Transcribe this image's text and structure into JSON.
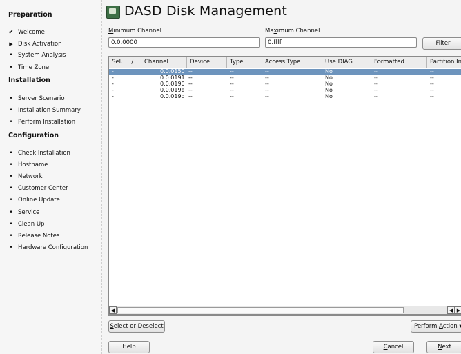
{
  "sidebar": {
    "sections": [
      {
        "title": "Preparation",
        "items": [
          {
            "label": "Welcome",
            "state": "done"
          },
          {
            "label": "Disk Activation",
            "state": "current"
          },
          {
            "label": "System Analysis",
            "state": "pending"
          },
          {
            "label": "Time Zone",
            "state": "pending"
          }
        ]
      },
      {
        "title": "Installation",
        "items": [
          {
            "label": "Server Scenario",
            "state": "pending"
          },
          {
            "label": "Installation Summary",
            "state": "pending"
          },
          {
            "label": "Perform Installation",
            "state": "pending"
          }
        ]
      },
      {
        "title": "Configuration",
        "items": [
          {
            "label": "Check Installation",
            "state": "pending"
          },
          {
            "label": "Hostname",
            "state": "pending"
          },
          {
            "label": "Network",
            "state": "pending"
          },
          {
            "label": "Customer Center",
            "state": "pending"
          },
          {
            "label": "Online Update",
            "state": "pending"
          },
          {
            "label": "Service",
            "state": "pending"
          },
          {
            "label": "Clean Up",
            "state": "pending"
          },
          {
            "label": "Release Notes",
            "state": "pending"
          },
          {
            "label": "Hardware Configuration",
            "state": "pending"
          }
        ]
      }
    ]
  },
  "page": {
    "title": "DASD Disk Management",
    "icon": "disk-management-icon"
  },
  "filters": {
    "min_label_pre": "",
    "min_label_key": "M",
    "min_label_post": "inimum Channel",
    "min_value": "0.0.0000",
    "max_label_pre": "Ma",
    "max_label_key": "x",
    "max_label_post": "imum Channel",
    "max_value": "0.ffff",
    "filter_key": "F",
    "filter_rest": "ilter"
  },
  "table": {
    "columns": [
      "Sel.",
      "Channel",
      "Device",
      "Type",
      "Access Type",
      "Use DIAG",
      "Formatted",
      "Partition Info"
    ],
    "sort_indicator": "/",
    "rows": [
      [
        "-",
        "0.0.0150",
        "--",
        "--",
        "--",
        "No",
        "--",
        "--"
      ],
      [
        "-",
        "0.0.0191",
        "--",
        "--",
        "--",
        "No",
        "--",
        "--"
      ],
      [
        "-",
        "0.0.0190",
        "--",
        "--",
        "--",
        "No",
        "--",
        "--"
      ],
      [
        "-",
        "0.0.019e",
        "--",
        "--",
        "--",
        "No",
        "--",
        "--"
      ],
      [
        "-",
        "0.0.019d",
        "--",
        "--",
        "--",
        "No",
        "--",
        "--"
      ]
    ],
    "selected_row": 0
  },
  "actions": {
    "select_key": "S",
    "select_rest": "elect or Deselect",
    "perform_pre": "Perform ",
    "perform_key": "A",
    "perform_rest": "ction",
    "help": "Help",
    "cancel_key": "C",
    "cancel_rest": "ancel",
    "next_key": "N",
    "next_rest": "ext"
  },
  "colors": {
    "selection": "#6d94bd",
    "title_icon": "#3d6f45"
  }
}
